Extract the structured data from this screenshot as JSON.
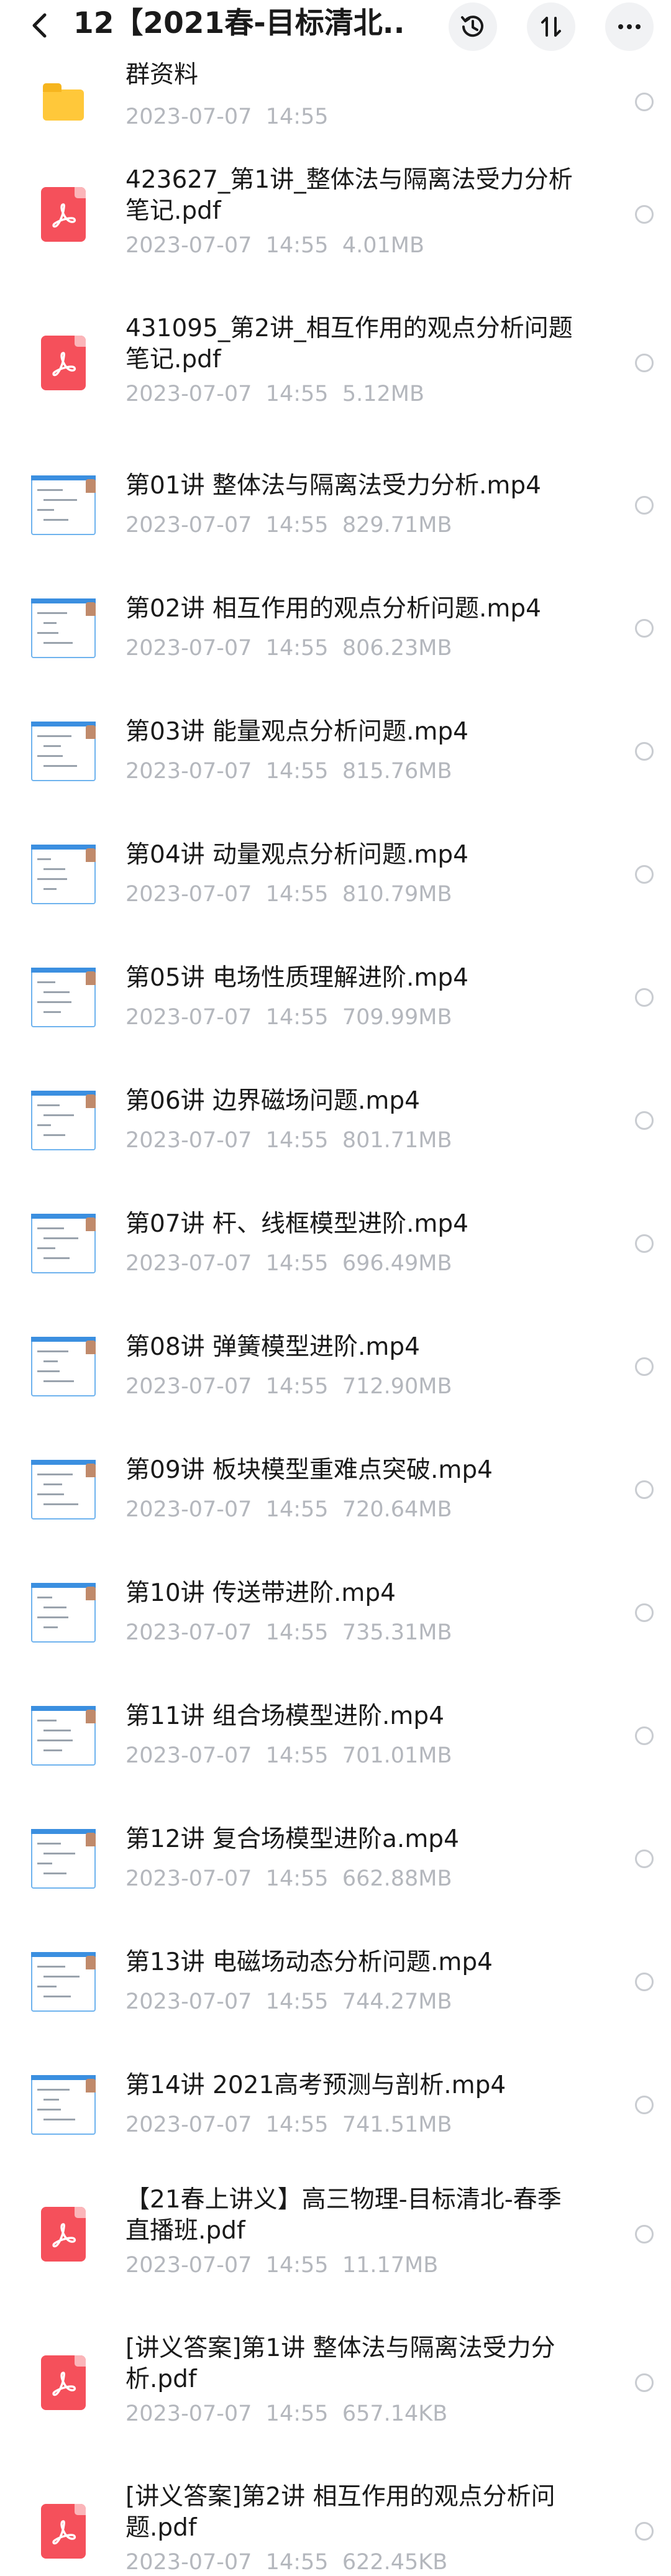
{
  "header": {
    "title": "12【2021春-目标清北...",
    "back_icon": "back-arrow-icon",
    "history_icon": "history-clock-icon",
    "sort_icon": "sort-arrows-icon",
    "more_icon": "more-dots-icon"
  },
  "colors": {
    "meta_text": "#b4b7bd",
    "pdf_red": "#f5505b",
    "folder_yellow": "#ffc83a",
    "thumb_blue": "#3b8fe0"
  },
  "files": [
    {
      "name": "群资料",
      "date": "2023-07-07",
      "time": "14:55",
      "size": "",
      "type": "folder"
    },
    {
      "name": "423627_第1讲_整体法与隔离法受力分析笔记.pdf",
      "date": "2023-07-07",
      "time": "14:55",
      "size": "4.01MB",
      "type": "pdf"
    },
    {
      "name": "431095_第2讲_相互作用的观点分析问题笔记.pdf",
      "date": "2023-07-07",
      "time": "14:55",
      "size": "5.12MB",
      "type": "pdf"
    },
    {
      "name": "第01讲 整体法与隔离法受力分析.mp4",
      "date": "2023-07-07",
      "time": "14:55",
      "size": "829.71MB",
      "type": "video"
    },
    {
      "name": "第02讲 相互作用的观点分析问题.mp4",
      "date": "2023-07-07",
      "time": "14:55",
      "size": "806.23MB",
      "type": "video"
    },
    {
      "name": "第03讲 能量观点分析问题.mp4",
      "date": "2023-07-07",
      "time": "14:55",
      "size": "815.76MB",
      "type": "video"
    },
    {
      "name": "第04讲 动量观点分析问题.mp4",
      "date": "2023-07-07",
      "time": "14:55",
      "size": "810.79MB",
      "type": "video"
    },
    {
      "name": "第05讲 电场性质理解进阶.mp4",
      "date": "2023-07-07",
      "time": "14:55",
      "size": "709.99MB",
      "type": "video"
    },
    {
      "name": "第06讲 边界磁场问题.mp4",
      "date": "2023-07-07",
      "time": "14:55",
      "size": "801.71MB",
      "type": "video"
    },
    {
      "name": "第07讲 杆、线框模型进阶.mp4",
      "date": "2023-07-07",
      "time": "14:55",
      "size": "696.49MB",
      "type": "video"
    },
    {
      "name": "第08讲 弹簧模型进阶.mp4",
      "date": "2023-07-07",
      "time": "14:55",
      "size": "712.90MB",
      "type": "video"
    },
    {
      "name": "第09讲 板块模型重难点突破.mp4",
      "date": "2023-07-07",
      "time": "14:55",
      "size": "720.64MB",
      "type": "video"
    },
    {
      "name": "第10讲 传送带进阶.mp4",
      "date": "2023-07-07",
      "time": "14:55",
      "size": "735.31MB",
      "type": "video"
    },
    {
      "name": "第11讲 组合场模型进阶.mp4",
      "date": "2023-07-07",
      "time": "14:55",
      "size": "701.01MB",
      "type": "video"
    },
    {
      "name": "第12讲 复合场模型进阶a.mp4",
      "date": "2023-07-07",
      "time": "14:55",
      "size": "662.88MB",
      "type": "video"
    },
    {
      "name": "第13讲 电磁场动态分析问题.mp4",
      "date": "2023-07-07",
      "time": "14:55",
      "size": "744.27MB",
      "type": "video"
    },
    {
      "name": "第14讲 2021高考预测与剖析.mp4",
      "date": "2023-07-07",
      "time": "14:55",
      "size": "741.51MB",
      "type": "video"
    },
    {
      "name": "【21春上讲义】高三物理-目标清北-春季直播班.pdf",
      "date": "2023-07-07",
      "time": "14:55",
      "size": "11.17MB",
      "type": "pdf"
    },
    {
      "name": "[讲义答案]第1讲 整体法与隔离法受力分析.pdf",
      "date": "2023-07-07",
      "time": "14:55",
      "size": "657.14KB",
      "type": "pdf"
    },
    {
      "name": "[讲义答案]第2讲 相互作用的观点分析问题.pdf",
      "date": "2023-07-07",
      "time": "14:55",
      "size": "622.45KB",
      "type": "pdf"
    }
  ]
}
